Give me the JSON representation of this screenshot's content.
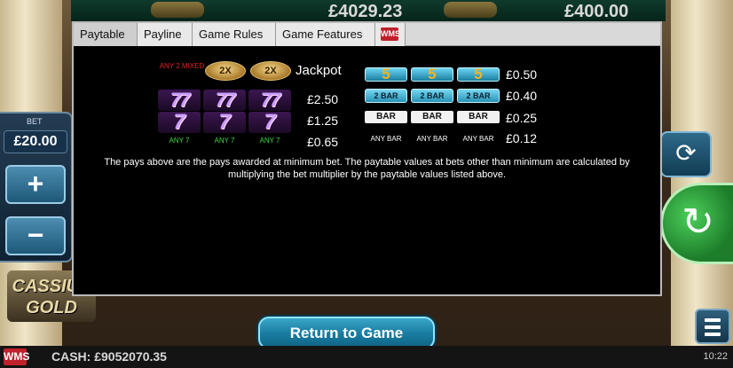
{
  "background": {
    "top_win_1": "£4029.23",
    "top_win_2": "£400.00",
    "bet_label": "BET",
    "bet_value": "£20.00",
    "plus_label": "+",
    "minus_label": "−",
    "logo_text": "CASSIUS GOLD",
    "cash_text": "CASH: £9052070.35",
    "clock": "10:22",
    "brand_icon": "WMS"
  },
  "tabs": [
    "Paytable",
    "Payline",
    "Game Rules",
    "Game Features"
  ],
  "tab_logo": "WMS",
  "paytable": {
    "left": {
      "jackpot_label": "ANY 2 MIXED",
      "jackpot_value": "Jackpot",
      "pays": [
        "£2.50",
        "£1.25",
        "£0.65"
      ],
      "any7_label": "ANY 7"
    },
    "right": {
      "pays": [
        "£0.50",
        "£0.40",
        "£0.25",
        "£0.12"
      ],
      "bar_label": "BAR",
      "any_bar_label": "ANY BAR"
    }
  },
  "description": "The pays above are the pays awarded at minimum bet. The paytable values at bets other than minimum are calculated by multiplying the bet multiplier by the paytable values listed above.",
  "return_button": "Return to Game"
}
